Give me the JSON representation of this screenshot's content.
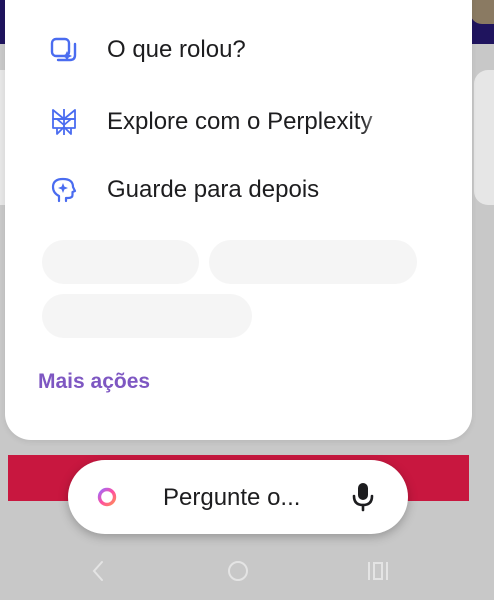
{
  "menu": {
    "items": [
      {
        "label": "O que rolou?",
        "icon": "news-spark-icon"
      },
      {
        "label": "Explore com o Perplexity",
        "icon": "perplexity-icon"
      },
      {
        "label": "Guarde para depois",
        "icon": "brain-spark-icon"
      }
    ],
    "more_label": "Mais ações"
  },
  "ask_bar": {
    "text": "Pergunte o...",
    "logo_icon": "assistant-ring-icon",
    "mic_icon": "microphone-icon"
  },
  "colors": {
    "accent": "#7e57c2",
    "icon_blue": "#4a6cf0",
    "red_bar": "#c8173f",
    "header": "#1f145e"
  },
  "navbar": {
    "icons": [
      "back-icon",
      "home-icon",
      "recents-icon"
    ]
  }
}
